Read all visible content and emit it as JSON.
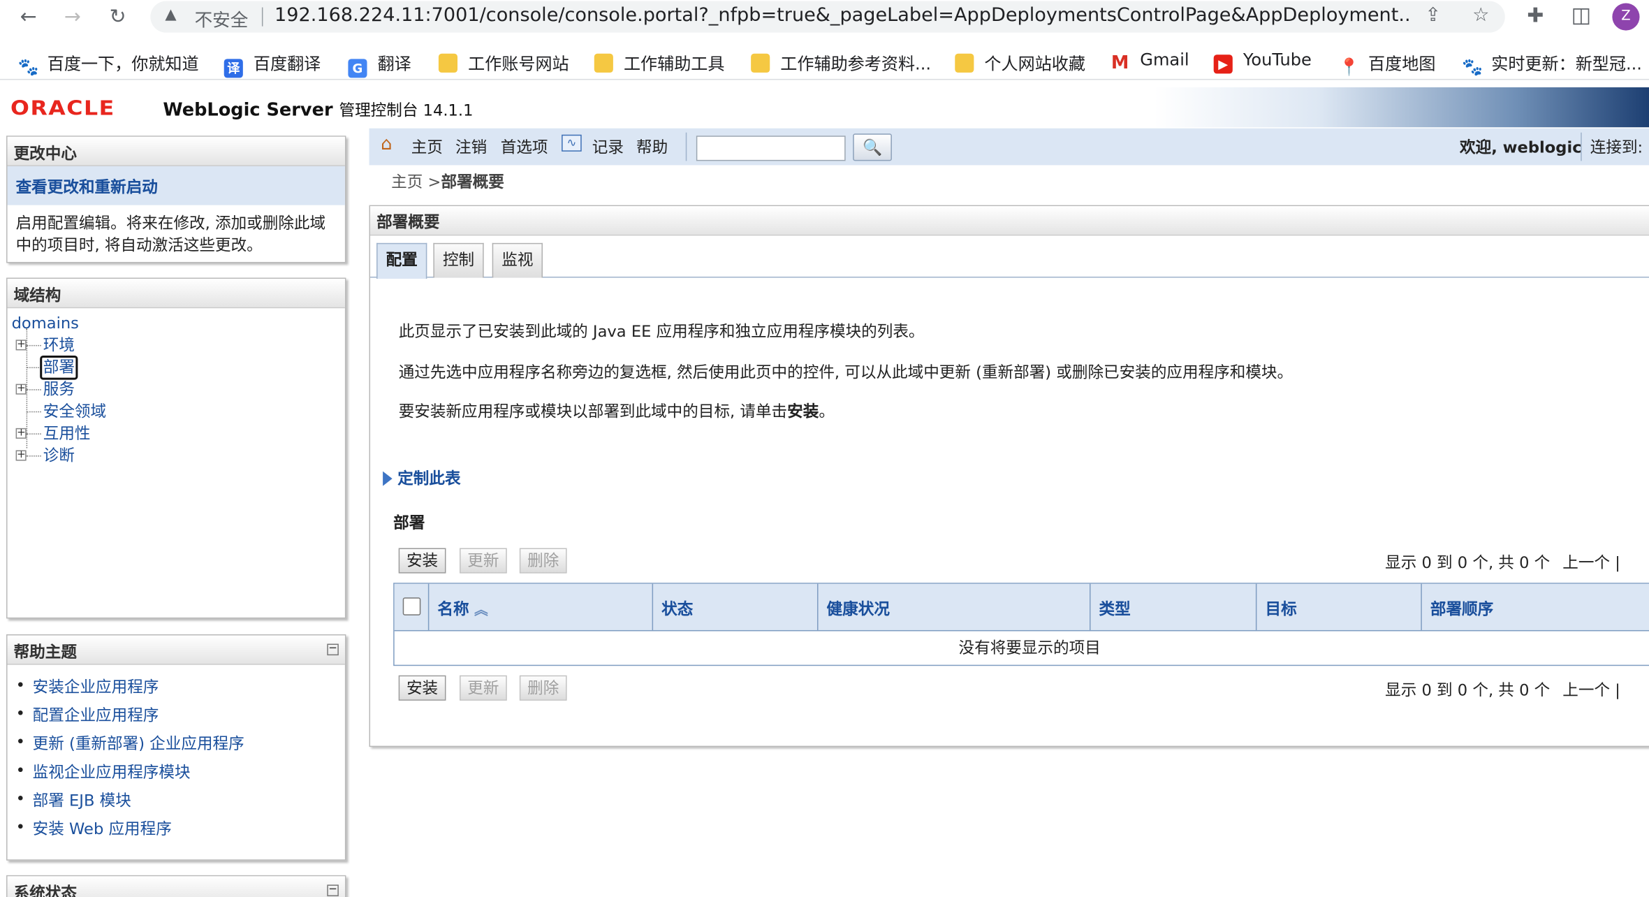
{
  "browser": {
    "insecure_label": "不安全",
    "url": "192.168.224.11:7001/console/console.portal?_nfpb=true&_pageLabel=AppDeploymentsControlPage&AppDeployment...",
    "profile_initial": "Z",
    "bookmarks": [
      {
        "label": "百度一下，你就知道",
        "icon": "baidu-paw-icon"
      },
      {
        "label": "百度翻译",
        "icon": "baidu-translate-icon"
      },
      {
        "label": "翻译",
        "icon": "google-translate-icon"
      },
      {
        "label": "工作账号网站",
        "icon": "folder-icon"
      },
      {
        "label": "工作辅助工具",
        "icon": "folder-icon"
      },
      {
        "label": "工作辅助参考资料...",
        "icon": "folder-icon"
      },
      {
        "label": "个人网站收藏",
        "icon": "folder-icon"
      },
      {
        "label": "Gmail",
        "icon": "gmail-icon"
      },
      {
        "label": "YouTube",
        "icon": "youtube-icon"
      },
      {
        "label": "百度地图",
        "icon": "baidu-map-icon"
      },
      {
        "label": "实时更新：新型冠...",
        "icon": "baidu-paw-icon"
      }
    ]
  },
  "header": {
    "logo": "ORACLE",
    "product": "WebLogic Server",
    "product_sub": "管理控制台 14.1.1"
  },
  "change_center": {
    "title": "更改中心",
    "link": "查看更改和重新启动",
    "text": "启用配置编辑。将来在修改, 添加或删除此域中的项目时, 将自动激活这些更改。"
  },
  "domain_structure": {
    "title": "域结构",
    "root": "domains",
    "items": [
      "环境",
      "部署",
      "服务",
      "安全领域",
      "互用性",
      "诊断"
    ]
  },
  "help_topics": {
    "title": "帮助主题",
    "items": [
      "安装企业应用程序",
      "配置企业应用程序",
      "更新 (重新部署) 企业应用程序",
      "监视企业应用程序模块",
      "部署 EJB 模块",
      "安装 Web 应用程序"
    ]
  },
  "system_status": {
    "title": "系统状态"
  },
  "toolbar": {
    "home": "主页",
    "logout": "注销",
    "preferences": "首选项",
    "record": "记录",
    "help": "帮助",
    "welcome": "欢迎, weblogic",
    "connected": "连接到:"
  },
  "breadcrumb": {
    "home": "主页",
    "sep": " >",
    "current": "部署概要"
  },
  "main": {
    "title": "部署概要",
    "tabs": [
      "配置",
      "控制",
      "监视"
    ],
    "desc1": "此页显示了已安装到此域的 Java EE 应用程序和独立应用程序模块的列表。",
    "desc2": "通过先选中应用程序名称旁边的复选框, 然后使用此页中的控件, 可以从此域中更新 (重新部署) 或删除已安装的应用程序和模块。",
    "desc3_prefix": "要安装新应用程序或模块以部署到此域中的目标, 请单击",
    "desc3_bold": "安装",
    "desc3_suffix": "。",
    "customize": "定制此表",
    "deployments_title": "部署",
    "buttons": {
      "install": "安装",
      "update": "更新",
      "delete": "删除"
    },
    "pager": {
      "text": "显示 0 到 0 个, 共 0 个",
      "prev": "上一个 |"
    },
    "columns": [
      "名称",
      "状态",
      "健康状况",
      "类型",
      "目标",
      "部署顺序"
    ],
    "empty_message": "没有将要显示的项目"
  }
}
